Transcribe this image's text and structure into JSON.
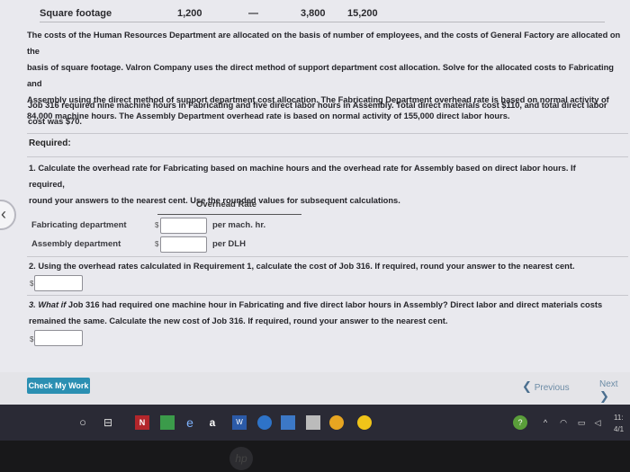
{
  "sqft": {
    "label": "Square footage",
    "values": [
      "1,200",
      "—",
      "3,800",
      "15,200"
    ]
  },
  "intro": {
    "lines": [
      "The costs of the Human Resources Department are allocated on the basis of number of employees, and the costs of General Factory are allocated on the",
      "basis of square footage. Valron Company uses the direct method of support department cost allocation. Solve for the allocated costs to Fabricating and",
      "Assembly using the direct method of support department cost allocation. The Fabricating Department overhead rate is based on normal activity of",
      "84,000 machine hours. The Assembly Department overhead rate is based on normal activity of 155,000 direct labor hours."
    ]
  },
  "job": {
    "lines": [
      "Job 316 required nine machine hours in Fabricating and five direct labor hours in Assembly. Total direct materials cost $110, and total direct labor",
      "cost was $70."
    ]
  },
  "required_label": "Required:",
  "q1": {
    "lines": [
      "1. Calculate the overhead rate for Fabricating based on machine hours and the overhead rate for Assembly based on direct labor hours. If required,",
      "round your answers to the nearest cent. Use the rounded values for subsequent calculations."
    ],
    "table_header": "Overhead Rate",
    "rows": [
      {
        "label": "Fabricating department",
        "dollar": "$",
        "unit": "per mach. hr."
      },
      {
        "label": "Assembly department",
        "dollar": "$",
        "unit": "per DLH"
      }
    ]
  },
  "q2": {
    "text": "2. Using the overhead rates calculated in Requirement 1, calculate the cost of Job 316. If required, round your answer to the nearest cent.",
    "dollar": "$"
  },
  "q3": {
    "bold_prefix": "3. What if",
    "lines": [
      " Job 316 had required one machine hour in Fabricating and five direct labor hours in Assembly? Direct labor and direct materials costs",
      "remained the same. Calculate the new cost of Job 316. If required, round your answer to the nearest cent."
    ],
    "dollar": "$"
  },
  "footer": {
    "check_label": "Check My Work",
    "prev_label": "Previous",
    "next_label": "Next"
  },
  "taskbar": {
    "clock_time": "11:",
    "clock_date": "4/1"
  },
  "brand": "hp"
}
